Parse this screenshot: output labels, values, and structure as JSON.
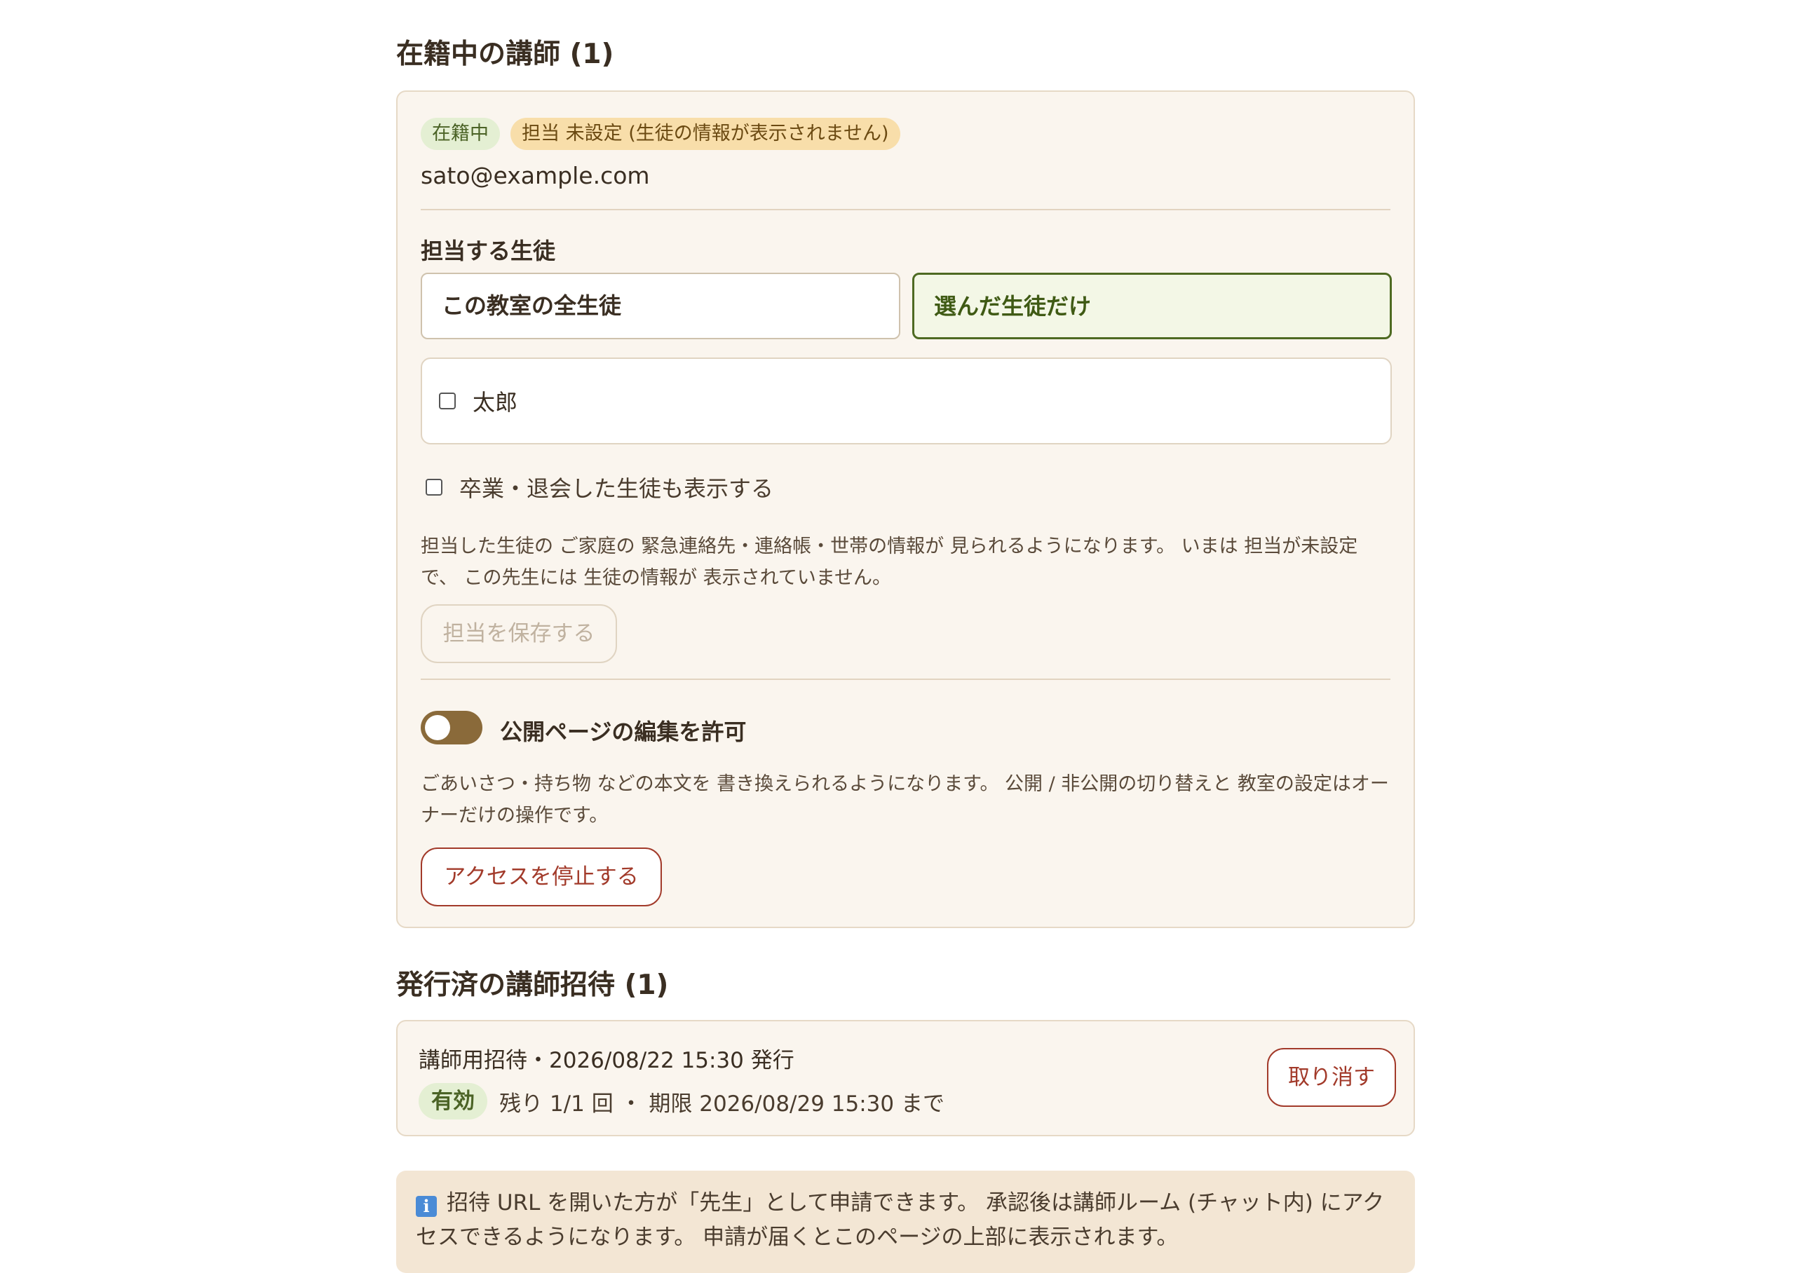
{
  "active_section": {
    "title": "在籍中の講師 (1)",
    "teacher": {
      "badge_status": "在籍中",
      "badge_assignment": "担当 未設定 (生徒の情報が表示されません)",
      "email": "sato@example.com",
      "students_heading": "担当する生徒",
      "option_all": "この教室の全生徒",
      "option_selected": "選んだ生徒だけ",
      "selected_option": "選んだ生徒だけ",
      "students": [
        {
          "name": "太郎",
          "checked": false
        }
      ],
      "show_graduated_label": "卒業・退会した生徒も表示する",
      "assignment_help": "担当した生徒の ご家庭の 緊急連絡先・連絡帳・世帯の情報が 見られるようになります。 いまは 担当が未設定で、 この先生には 生徒の情報が 表示されていません。",
      "save_button": "担当を保存する",
      "public_edit_label": "公開ページの編集を許可",
      "public_edit_enabled": false,
      "public_edit_help": "ごあいさつ・持ち物 などの本文を 書き換えられるようになります。 公開 / 非公開の切り替えと 教室の設定はオーナーだけの操作です。",
      "revoke_button": "アクセスを停止する"
    }
  },
  "invites_section": {
    "title": "発行済の講師招待 (1)",
    "invite": {
      "heading": "講師用招待・2026/08/22 15:30 発行",
      "status_badge": "有効",
      "details": "残り 1/1 回 ・ 期限 2026/08/29 15:30 まで",
      "cancel_button": "取り消す"
    }
  },
  "info_box": {
    "icon": "info-icon",
    "text": "招待 URL を開いた方が「先生」として申請できます。 承認後は講師ルーム (チャット内) にアクセスできるようになります。 申請が届くとこのページの上部に表示されます。"
  },
  "colors": {
    "card_bg": "#faf5ee",
    "card_border": "#e6d9c6",
    "accent_green": "#4b6326",
    "selected_bg": "#f3f7e6",
    "danger": "#a23a2a",
    "toggle_off": "#8a6a3a",
    "info_bg": "#f3e6d4",
    "info_icon": "#4a8bd6"
  }
}
